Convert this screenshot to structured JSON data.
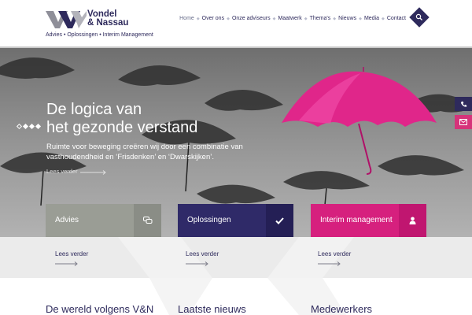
{
  "brand": {
    "name_line1": "Vondel",
    "name_line2": "& Nassau",
    "tagline": "Advies • Oplossingen • Interim Management"
  },
  "nav": {
    "items": [
      {
        "label": "Home",
        "active": true
      },
      {
        "label": "Over ons"
      },
      {
        "label": "Onze adviseurs"
      },
      {
        "label": "Maatwerk"
      },
      {
        "label": "Thema's"
      },
      {
        "label": "Nieuws"
      },
      {
        "label": "Media"
      },
      {
        "label": "Contact"
      }
    ],
    "search_icon": "search-icon"
  },
  "hero": {
    "title_line1": "De logica van",
    "title_line2": "het gezonde verstand",
    "subtitle": "Ruimte voor beweging creëren wij door een combinatie van vasthoudendheid en ‘Frisdenken’ en ‘Dwarskijken’.",
    "read_more": "Lees verder",
    "slide_count": 4,
    "active_slide": 1
  },
  "side_buttons": {
    "phone_icon": "phone-icon",
    "mail_icon": "mail-icon"
  },
  "tiles": [
    {
      "label": "Advies",
      "icon": "chat-icon",
      "color": "#9a9d95"
    },
    {
      "label": "Oplossingen",
      "icon": "check-icon",
      "color": "#2f2a68"
    },
    {
      "label": "Interim management",
      "icon": "user-icon",
      "color": "#d6207e"
    }
  ],
  "band": {
    "read_more_1": "Lees verder",
    "read_more_2": "Lees verder",
    "read_more_3": "Lees verder"
  },
  "sections": {
    "col1_title": "De wereld volgens V&N",
    "col2_title": "Laatste nieuws",
    "col3_title": "Medewerkers"
  },
  "colors": {
    "primary": "#2e2a5c",
    "accent": "#d6207e",
    "grey_tile": "#9a9d95"
  }
}
